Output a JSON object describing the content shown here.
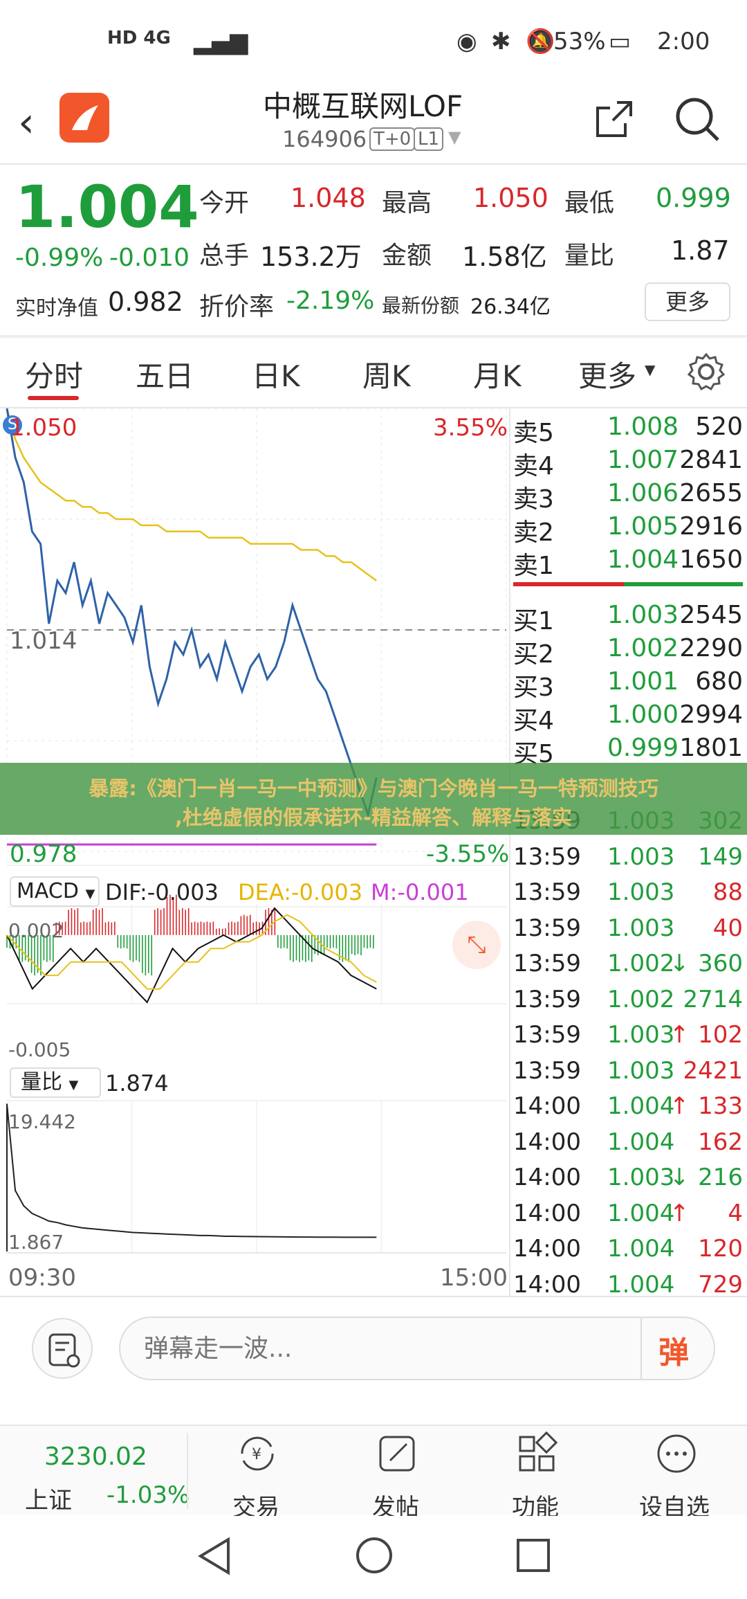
{
  "status": {
    "left_icons": "HD 4G",
    "battery": "53%",
    "time": "2:00"
  },
  "header": {
    "title": "中概互联网LOF",
    "code": "164906",
    "badge_t0": "T+0",
    "badge_l1": "L1"
  },
  "quote": {
    "price": "1.004",
    "change_pct": "-0.99%",
    "change": "-0.010",
    "open_label": "今开",
    "open": "1.048",
    "high_label": "最高",
    "high": "1.050",
    "low_label": "最低",
    "low": "0.999",
    "volume_label": "总手",
    "volume": "153.2万",
    "amount_label": "金额",
    "amount": "1.58亿",
    "ratio_label": "量比",
    "ratio": "1.87",
    "nav_label": "实时净值",
    "nav": "0.982",
    "discount_label": "折价率",
    "discount": "-2.19%",
    "shares_label": "最新份额",
    "shares": "26.34亿",
    "more_button": "更多"
  },
  "tabs": [
    {
      "label": "分时"
    },
    {
      "label": "五日"
    },
    {
      "label": "日K"
    },
    {
      "label": "周K"
    },
    {
      "label": "月K"
    },
    {
      "label": "更多"
    }
  ],
  "intraday": {
    "top_price": "1.050",
    "top_pct": "3.55%",
    "mid_price": "1.014",
    "bottom_price": "0.978",
    "bottom_pct": "-3.55%",
    "price_series": [
      1.05,
      1.042,
      1.038,
      1.03,
      1.028,
      1.015,
      1.022,
      1.02,
      1.025,
      1.018,
      1.022,
      1.015,
      1.02,
      1.018,
      1.016,
      1.012,
      1.018,
      1.008,
      1.002,
      1.006,
      1.012,
      1.01,
      1.014,
      1.008,
      1.01,
      1.006,
      1.012,
      1.008,
      1.004,
      1.008,
      1.01,
      1.006,
      1.008,
      1.012,
      1.018,
      1.014,
      1.01,
      1.006,
      1.004,
      1.0,
      0.996,
      0.992,
      0.988,
      0.984,
      0.99
    ],
    "avg_series": [
      1.05,
      1.045,
      1.042,
      1.04,
      1.038,
      1.037,
      1.036,
      1.035,
      1.035,
      1.034,
      1.034,
      1.033,
      1.033,
      1.032,
      1.032,
      1.032,
      1.031,
      1.031,
      1.031,
      1.03,
      1.03,
      1.03,
      1.03,
      1.03,
      1.029,
      1.029,
      1.029,
      1.029,
      1.029,
      1.028,
      1.028,
      1.028,
      1.028,
      1.028,
      1.028,
      1.027,
      1.027,
      1.027,
      1.026,
      1.026,
      1.025,
      1.025,
      1.024,
      1.023,
      1.022
    ],
    "time_start": "09:30",
    "time_end": "15:00"
  },
  "macd": {
    "label": "MACD",
    "dif": "DIF:-0.003",
    "dea": "DEA:-0.003",
    "m": "M:-0.001",
    "top": "0.002",
    "bottom": "-0.005",
    "hist": [
      -0.001,
      -0.002,
      -0.003,
      -0.002,
      0.001,
      0.002,
      0.001,
      0.002,
      0.001,
      -0.001,
      -0.002,
      -0.003,
      0.002,
      0.003,
      0.002,
      0.001,
      0.001,
      0.0005,
      0.001,
      0.0015,
      0.001,
      0.002,
      -0.001,
      -0.002,
      -0.002,
      -0.0015,
      -0.001,
      -0.002,
      -0.0015,
      -0.001
    ],
    "dif_series": [
      0.0,
      -0.002,
      -0.004,
      -0.003,
      -0.002,
      -0.001,
      -0.002,
      -0.001,
      -0.002,
      -0.003,
      -0.004,
      -0.005,
      -0.003,
      -0.001,
      -0.002,
      -0.001,
      -0.0005,
      0.0,
      -0.0005,
      0.0,
      0.0005,
      0.002,
      0.001,
      0.0,
      -0.001,
      -0.0015,
      -0.002,
      -0.003,
      -0.0035,
      -0.004
    ],
    "dea_series": [
      0.0,
      -0.001,
      -0.002,
      -0.003,
      -0.003,
      -0.002,
      -0.002,
      -0.002,
      -0.002,
      -0.002,
      -0.003,
      -0.004,
      -0.004,
      -0.003,
      -0.002,
      -0.002,
      -0.001,
      -0.001,
      -0.0005,
      -0.0005,
      0.0,
      0.001,
      0.0015,
      0.001,
      0.0,
      -0.001,
      -0.0015,
      -0.002,
      -0.003,
      -0.0035
    ]
  },
  "volratio": {
    "label": "量比",
    "value": "1.874",
    "top": "19.442",
    "bottom": "1.867",
    "series": [
      19.4,
      8,
      6,
      5,
      4.5,
      4,
      3.8,
      3.5,
      3.3,
      3.1,
      3.0,
      2.9,
      2.8,
      2.7,
      2.6,
      2.5,
      2.45,
      2.4,
      2.35,
      2.3,
      2.25,
      2.2,
      2.15,
      2.1,
      2.1,
      2.05,
      2.0,
      2.0,
      1.98,
      1.96,
      1.95,
      1.94,
      1.93,
      1.92,
      1.91,
      1.9,
      1.9,
      1.89,
      1.88,
      1.88,
      1.87,
      1.87,
      1.87,
      1.87,
      1.867
    ]
  },
  "orderbook": {
    "asks": [
      {
        "label": "卖5",
        "price": "1.008",
        "vol": "520"
      },
      {
        "label": "卖4",
        "price": "1.007",
        "vol": "2841"
      },
      {
        "label": "卖3",
        "price": "1.006",
        "vol": "2655"
      },
      {
        "label": "卖2",
        "price": "1.005",
        "vol": "2916"
      },
      {
        "label": "卖1",
        "price": "1.004",
        "vol": "1650"
      }
    ],
    "bids": [
      {
        "label": "买1",
        "price": "1.003",
        "vol": "2545"
      },
      {
        "label": "买2",
        "price": "1.002",
        "vol": "2290"
      },
      {
        "label": "买3",
        "price": "1.001",
        "vol": "680"
      },
      {
        "label": "买4",
        "price": "1.000",
        "vol": "2994"
      },
      {
        "label": "买5",
        "price": "0.999",
        "vol": "1801"
      }
    ]
  },
  "ticks": [
    {
      "time": "13:59",
      "price": "1.003",
      "arrow": "",
      "vol": "302",
      "color": "green"
    },
    {
      "time": "13:59",
      "price": "1.003",
      "arrow": "",
      "vol": "149",
      "color": "green"
    },
    {
      "time": "13:59",
      "price": "1.003",
      "arrow": "",
      "vol": "88",
      "color": "red"
    },
    {
      "time": "13:59",
      "price": "1.003",
      "arrow": "",
      "vol": "40",
      "color": "red"
    },
    {
      "time": "13:59",
      "price": "1.002",
      "arrow": "↓",
      "vol": "360",
      "color": "green"
    },
    {
      "time": "13:59",
      "price": "1.002",
      "arrow": "",
      "vol": "2714",
      "color": "green"
    },
    {
      "time": "13:59",
      "price": "1.003",
      "arrow": "↑",
      "vol": "102",
      "color": "red"
    },
    {
      "time": "13:59",
      "price": "1.003",
      "arrow": "",
      "vol": "2421",
      "color": "red"
    },
    {
      "time": "14:00",
      "price": "1.004",
      "arrow": "↑",
      "vol": "133",
      "color": "red"
    },
    {
      "time": "14:00",
      "price": "1.004",
      "arrow": "",
      "vol": "162",
      "color": "red"
    },
    {
      "time": "14:00",
      "price": "1.003",
      "arrow": "↓",
      "vol": "216",
      "color": "green"
    },
    {
      "time": "14:00",
      "price": "1.004",
      "arrow": "↑",
      "vol": "4",
      "color": "red"
    },
    {
      "time": "14:00",
      "price": "1.004",
      "arrow": "",
      "vol": "120",
      "color": "red"
    },
    {
      "time": "14:00",
      "price": "1.004",
      "arrow": "",
      "vol": "729",
      "color": "red"
    }
  ],
  "banner": {
    "line1": "暴露:《澳门一肖一马一中预测》与澳门今晚肖一马一特预测技巧",
    "line2": ",杜绝虚假的假承诺环-精益解答、解释与落实"
  },
  "comment": {
    "placeholder": "弹幕走一波...",
    "danmu": "弹"
  },
  "bottom_nav": {
    "index_value": "3230.02",
    "index_name": "上证",
    "index_change": "-1.03%",
    "items": [
      {
        "label": "交易"
      },
      {
        "label": "发帖"
      },
      {
        "label": "功能"
      },
      {
        "label": "设自选"
      }
    ]
  },
  "colors": {
    "price_line": "#2e62a8",
    "avg_line": "#e6c21a",
    "up": "#d8272b",
    "down": "#1f9d3b",
    "logo": "#f2572c"
  }
}
